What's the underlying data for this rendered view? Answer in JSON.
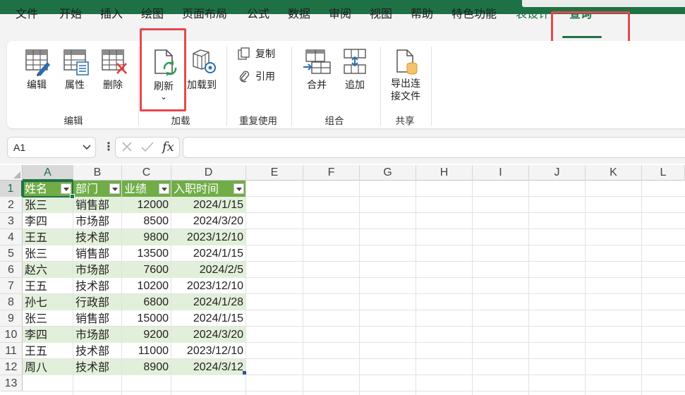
{
  "menu": {
    "tabs": [
      {
        "label": "文件"
      },
      {
        "label": "开始"
      },
      {
        "label": "插入"
      },
      {
        "label": "绘图"
      },
      {
        "label": "页面布局"
      },
      {
        "label": "公式"
      },
      {
        "label": "数据"
      },
      {
        "label": "审阅"
      },
      {
        "label": "视图"
      },
      {
        "label": "帮助"
      },
      {
        "label": "特色功能"
      },
      {
        "label": "表设计"
      },
      {
        "label": "查询"
      }
    ],
    "active_tab": "查询"
  },
  "ribbon": {
    "edit_group": {
      "label": "编辑",
      "buttons": [
        {
          "label": "编辑",
          "icon": "table-pencil-icon"
        },
        {
          "label": "属性",
          "icon": "table-properties-icon"
        },
        {
          "label": "删除",
          "icon": "table-delete-icon"
        }
      ]
    },
    "load_group": {
      "label": "加载",
      "refresh_label": "刷新",
      "refresh_dropdown": "⌄",
      "load_to_label": "加载到"
    },
    "reuse_group": {
      "label": "重复使用",
      "copy_label": "复制",
      "reference_label": "引用"
    },
    "combine_group": {
      "label": "组合",
      "merge_label": "合并",
      "append_label": "追加"
    },
    "share_group": {
      "label": "共享",
      "export_label_1": "导出连",
      "export_label_2": "接文件"
    }
  },
  "formula_bar": {
    "name_box": "A1",
    "fx_label": "fx",
    "formula": ""
  },
  "sheet": {
    "columns": [
      "A",
      "B",
      "C",
      "D",
      "E",
      "F",
      "G",
      "H",
      "I",
      "J",
      "K",
      "L"
    ],
    "row_numbers": [
      "1",
      "2",
      "3",
      "4",
      "5",
      "6",
      "7",
      "8",
      "9",
      "10",
      "11",
      "12",
      "13"
    ],
    "selected_column": "A",
    "selected_row": "1",
    "table_headers": [
      "姓名",
      "部门",
      "业绩",
      "入职时间"
    ],
    "table_rows": [
      [
        "张三",
        "销售部",
        "12000",
        "2024/1/15"
      ],
      [
        "李四",
        "市场部",
        "8500",
        "2024/3/20"
      ],
      [
        "王五",
        "技术部",
        "9800",
        "2023/12/10"
      ],
      [
        "张三",
        "销售部",
        "13500",
        "2024/1/15"
      ],
      [
        "赵六",
        "市场部",
        "7600",
        "2024/2/5"
      ],
      [
        "王五",
        "技术部",
        "10200",
        "2023/12/10"
      ],
      [
        "孙七",
        "行政部",
        "6800",
        "2024/1/28"
      ],
      [
        "张三",
        "销售部",
        "15000",
        "2024/1/15"
      ],
      [
        "李四",
        "市场部",
        "9200",
        "2024/3/20"
      ],
      [
        "王五",
        "技术部",
        "11000",
        "2023/12/10"
      ],
      [
        "周八",
        "技术部",
        "8900",
        "2024/3/12"
      ]
    ]
  },
  "colors": {
    "brand_green": "#1e7145",
    "table_header": "#70ad47",
    "table_band": "#e2efda",
    "highlight_red": "#e5484d"
  }
}
